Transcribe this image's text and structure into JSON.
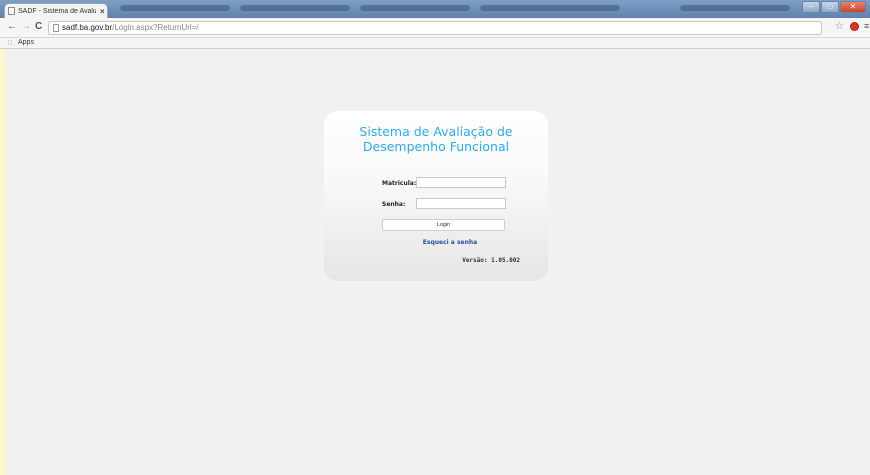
{
  "browser": {
    "tab_title": "SADF - Sistema de Avaliaç",
    "tab_close": "×",
    "url_host": "sadf.ba.gov.br",
    "url_path": "/Login.aspx?ReturnUrl=/",
    "bookmarks_apps": "Apps",
    "window_controls": [
      "–",
      "□",
      "✕"
    ]
  },
  "login": {
    "title_line1": "Sistema de Avaliação de",
    "title_line2": "Desempenho Funcional",
    "matricula_label": "Matricula:",
    "matricula_value": "",
    "senha_label": "Senha:",
    "senha_value": "",
    "login_button": "Login",
    "forgot_link": "Esqueci a senha",
    "version": "Versão: 1.05.002"
  },
  "colors": {
    "title_blue": "#33a8e4",
    "link_blue": "#2a4f9c",
    "side_strip": "#fdf6cf"
  }
}
